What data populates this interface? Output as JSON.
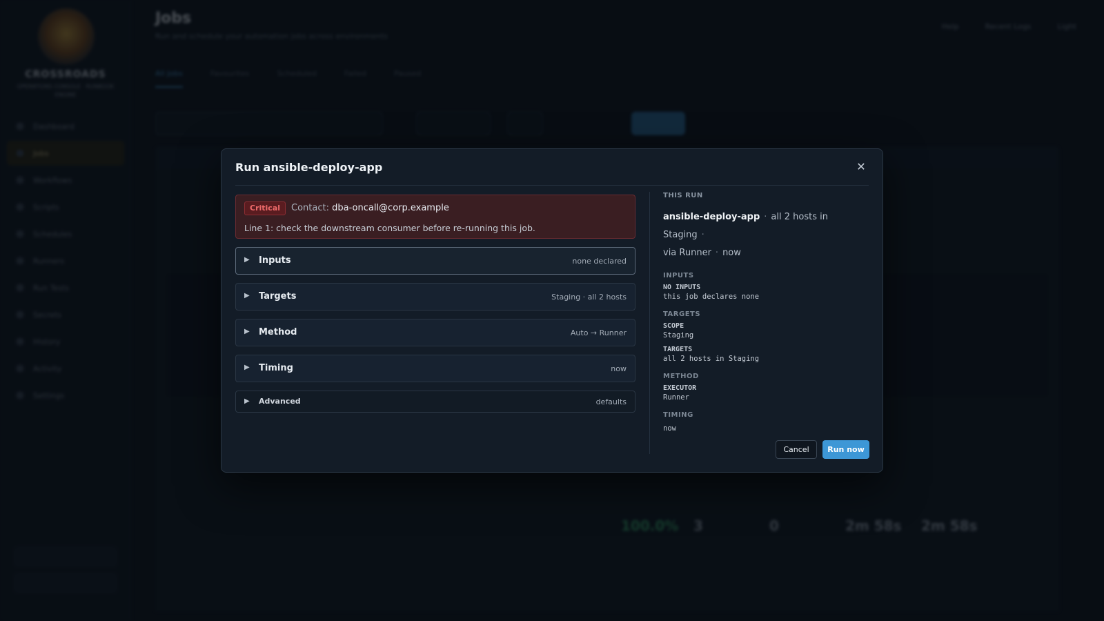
{
  "background": {
    "brand": {
      "title": "CROSSROADS",
      "subtitle": "OPERATIONS CONSOLE · RUNBOOK ENGINE"
    },
    "nav": [
      "Dashboard",
      "Jobs",
      "Workflows",
      "Scripts",
      "Schedules",
      "Runners",
      "Run Tests",
      "Secrets",
      "History",
      "Activity",
      "Settings"
    ],
    "page_title": "Jobs",
    "page_subtitle": "Run and schedule your automation jobs across environments",
    "top_actions": [
      "Help",
      "Recent Logs",
      "Light"
    ],
    "tabs": [
      "All Jobs",
      "Favourites",
      "Scheduled",
      "Failed",
      "Paused"
    ],
    "metrics": {
      "success": "100.0%",
      "runs": "3",
      "failures": "0",
      "p50": "2m 58s",
      "p95": "2m 58s"
    }
  },
  "modal": {
    "title": "Run ansible-deploy-app",
    "close_glyph": "✕",
    "alert": {
      "badge": "Critical",
      "contact_label": "Contact:",
      "contact_email": "dba-oncall@corp.example",
      "message": "Line 1: check the downstream consumer before re-running this job."
    },
    "sections": [
      {
        "label": "Inputs",
        "meta": "none declared"
      },
      {
        "label": "Targets",
        "meta": "Staging · all 2 hosts"
      },
      {
        "label": "Method",
        "meta": "Auto → Runner"
      },
      {
        "label": "Timing",
        "meta": "now"
      },
      {
        "label": "Advanced",
        "meta": "defaults"
      }
    ],
    "summary": {
      "caption": "THIS RUN",
      "job": "ansible-deploy-app",
      "targets": "all 2 hosts in Staging",
      "via": "via Runner",
      "when": "now",
      "inputs_title": "INPUTS",
      "inputs_key": "NO INPUTS",
      "inputs_val": "this job declares none",
      "targets_title": "TARGETS",
      "scope_key": "SCOPE",
      "scope_val": "Staging",
      "targets_key": "TARGETS",
      "targets_val": "all 2 hosts in Staging",
      "method_title": "METHOD",
      "executor_key": "EXECUTOR",
      "executor_val": "Runner",
      "timing_title": "TIMING",
      "timing_val": "now"
    },
    "buttons": {
      "cancel": "Cancel",
      "run": "Run now"
    }
  },
  "colors": {
    "accent": "#3d97d6",
    "critical": "#ef6b6b",
    "alert_bg": "#3a1e22",
    "modal_bg": "#131c27"
  }
}
